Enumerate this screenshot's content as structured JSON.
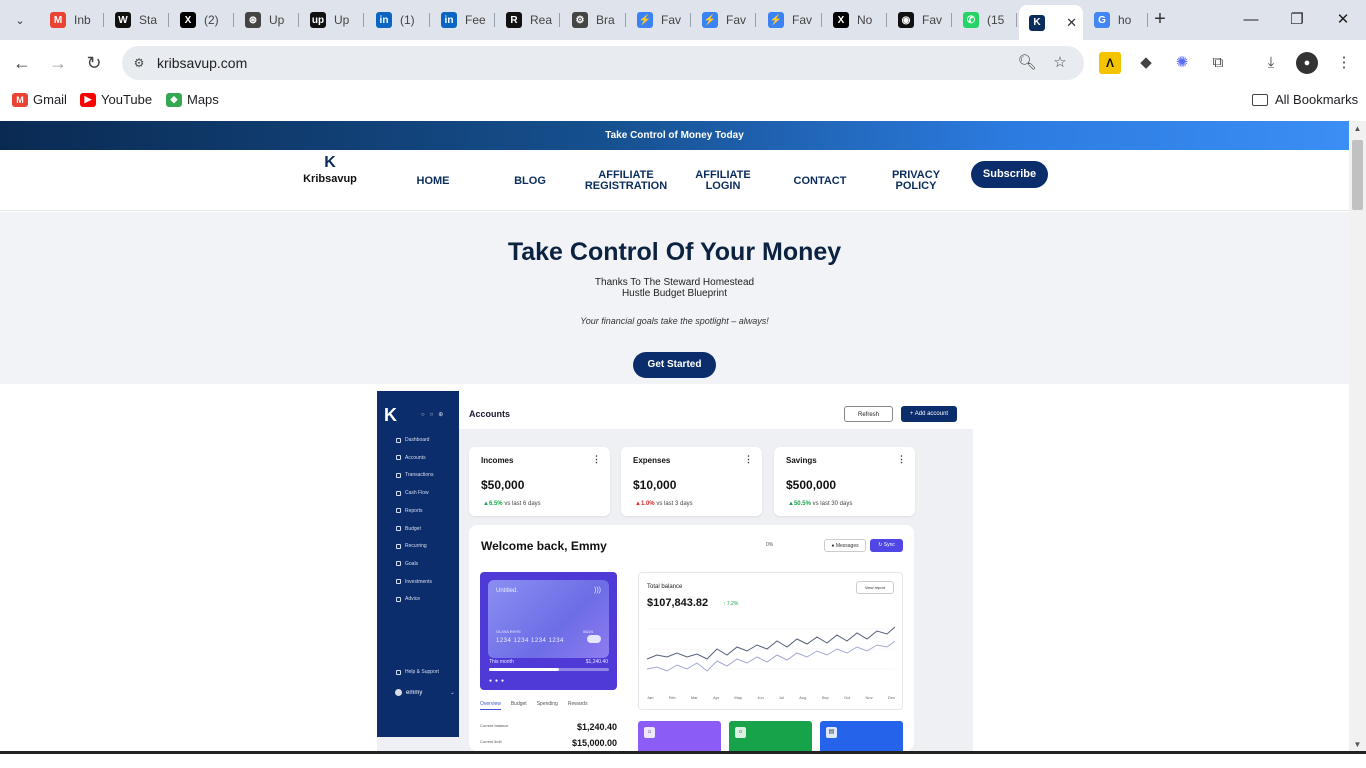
{
  "browser": {
    "tabs": [
      {
        "label": "Inb",
        "icon": "gmail-icon",
        "color": "#ea4335",
        "glyph": "M"
      },
      {
        "label": "Sta",
        "icon": "wikipedia-icon",
        "color": "#111111",
        "glyph": "W"
      },
      {
        "label": "(2)",
        "icon": "x-icon",
        "color": "#000000",
        "glyph": "X"
      },
      {
        "label": "Up",
        "icon": "openai-icon",
        "color": "#444444",
        "glyph": "⊛"
      },
      {
        "label": "Up",
        "icon": "upwork-icon",
        "color": "#111111",
        "glyph": "up"
      },
      {
        "label": "(1)",
        "icon": "linkedin-icon",
        "color": "#0a66c2",
        "glyph": "in"
      },
      {
        "label": "Fee",
        "icon": "linkedin-icon",
        "color": "#0a66c2",
        "glyph": "in"
      },
      {
        "label": "Rea",
        "icon": "r-app-icon",
        "color": "#111111",
        "glyph": "R"
      },
      {
        "label": "Bra",
        "icon": "gear-icon",
        "color": "#444444",
        "glyph": "⚙"
      },
      {
        "label": "Fav",
        "icon": "bolt-icon",
        "color": "#3b82f6",
        "glyph": "⚡"
      },
      {
        "label": "Fav",
        "icon": "bolt-icon",
        "color": "#3b82f6",
        "glyph": "⚡"
      },
      {
        "label": "Fav",
        "icon": "bolt-icon",
        "color": "#3b82f6",
        "glyph": "⚡"
      },
      {
        "label": "No",
        "icon": "x-icon",
        "color": "#000000",
        "glyph": "X"
      },
      {
        "label": "Fav",
        "icon": "github-icon",
        "color": "#111111",
        "glyph": "◉"
      },
      {
        "label": "(15",
        "icon": "whatsapp-icon",
        "color": "#25d366",
        "glyph": "✆"
      },
      {
        "label": "",
        "icon": "kribsavup-icon",
        "color": "#0b2d5c",
        "glyph": "K"
      },
      {
        "label": "ho",
        "icon": "google-icon",
        "color": "#4285f4",
        "glyph": "G"
      }
    ],
    "active_tab_index": 15,
    "url": "kribsavup.com",
    "bookmarks": [
      {
        "label": "Gmail",
        "icon": "gmail-icon",
        "color": "#ea4335",
        "glyph": "M"
      },
      {
        "label": "YouTube",
        "icon": "youtube-icon",
        "color": "#ff0000",
        "glyph": "▶"
      },
      {
        "label": "Maps",
        "icon": "maps-icon",
        "color": "#34a853",
        "glyph": "◆"
      }
    ],
    "all_bookmarks_label": "All Bookmarks"
  },
  "site": {
    "promo_text": "Take Control of Money Today",
    "logo_text": "Kribsavup",
    "nav": [
      {
        "label": "HOME"
      },
      {
        "label": "BLOG"
      },
      {
        "label": "AFFILIATE REGISTRATION"
      },
      {
        "label": "AFFILIATE LOGIN"
      },
      {
        "label": "CONTACT"
      },
      {
        "label": "PRIVACY POLICY"
      }
    ],
    "subscribe_label": "Subscribe",
    "hero": {
      "title": "Take Control Of Your Money",
      "subtitle_line1": "Thanks To The Steward Homestead",
      "subtitle_line2": "Hustle Budget Blueprint",
      "tagline": "Your financial goals take the spotlight – always!",
      "cta_label": "Get Started"
    }
  },
  "dashboard": {
    "sidebar_items": [
      "Dashboard",
      "Accounts",
      "Transactions",
      "Cash Flow",
      "Reports",
      "Budget",
      "Recurring",
      "Goals",
      "Investments",
      "Advice"
    ],
    "help_label": "Help & Support",
    "user_name": "emmy",
    "header_title": "Accounts",
    "refresh_label": "Refresh",
    "add_account_label": "+ Add account",
    "stats": [
      {
        "label": "Incomes",
        "value": "$50,000",
        "change": "6.5%",
        "period": "vs last 6 days",
        "direction": "up"
      },
      {
        "label": "Expenses",
        "value": "$10,000",
        "change": "1.0%",
        "period": "vs last 3 days",
        "direction": "down"
      },
      {
        "label": "Savings",
        "value": "$500,000",
        "change": "50.5%",
        "period": "vs last 30 days",
        "direction": "up"
      }
    ],
    "welcome": "Welcome back, Emmy",
    "percent_mark": "0%",
    "messages_label": "Messages",
    "sync_label": "Sync",
    "card": {
      "name": "Untitled.",
      "holder": "OLIVIA RHYE",
      "expiry": "06/24",
      "number": "1234 1234 1234 1234",
      "this_month_label": "This month",
      "this_month_value": "$1,240.40",
      "month_progress": 0.58
    },
    "panel_tabs": [
      "Overview",
      "Budget",
      "Spending",
      "Rewards"
    ],
    "current_balance_label": "Current balance",
    "current_balance_value": "$1,240.40",
    "current_limit_label": "Current limit",
    "current_limit_value": "$15,000.00",
    "total_balance_label": "Total balance",
    "total_balance_value": "$107,843.82",
    "total_balance_change": "7.2%",
    "view_report_label": "View report",
    "months": [
      "Jan",
      "Feb",
      "Mar",
      "Apr",
      "May",
      "Jun",
      "Jul",
      "Aug",
      "Sep",
      "Oct",
      "Nov",
      "Dec"
    ],
    "tile_colors": [
      "#8b5cf6",
      "#16a34a",
      "#2563eb"
    ]
  }
}
